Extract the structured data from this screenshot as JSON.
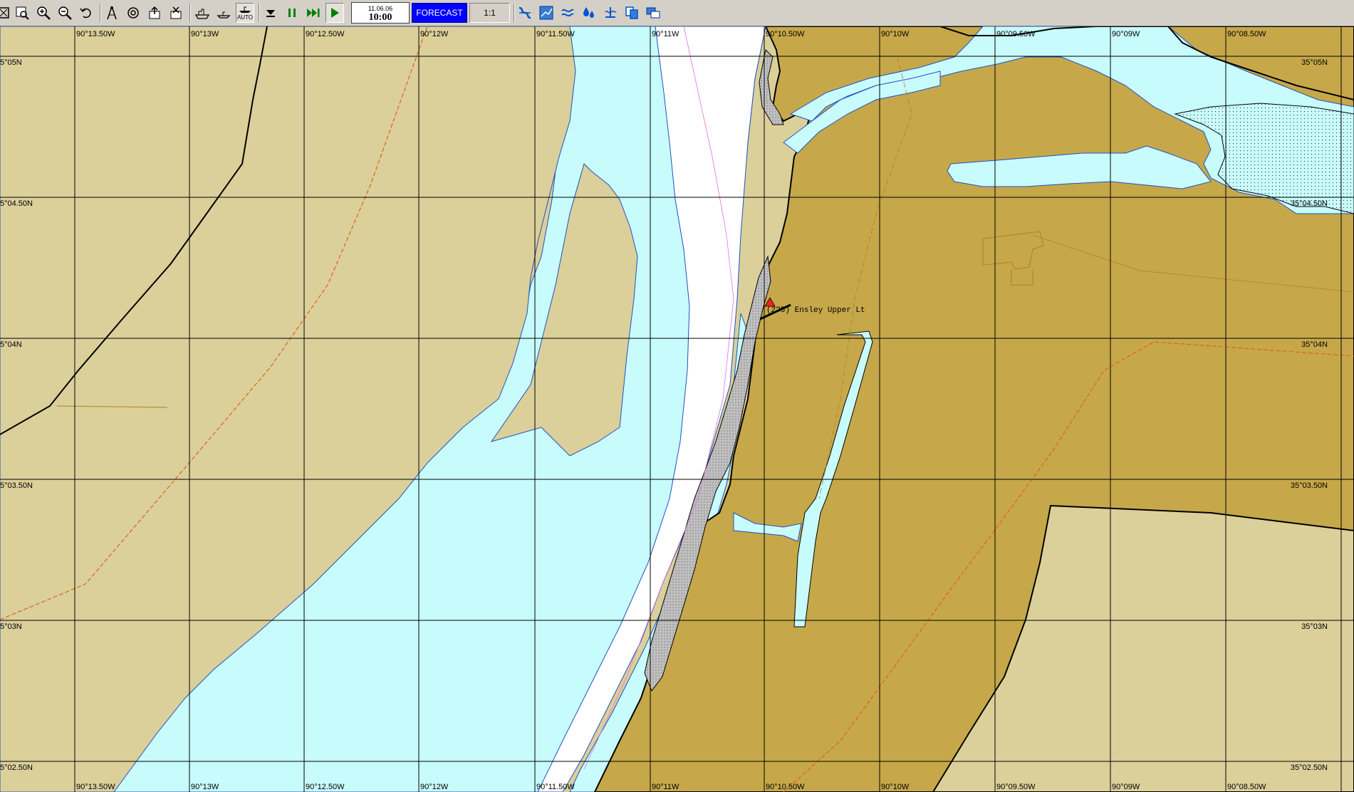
{
  "toolbar": {
    "buttons": [
      {
        "name": "select-icon"
      },
      {
        "name": "zoom-window-icon"
      },
      {
        "name": "zoom-in-icon"
      },
      {
        "name": "zoom-out-icon"
      },
      {
        "name": "undo-view-icon"
      },
      {
        "name": "compass-icon"
      },
      {
        "name": "target-icon"
      },
      {
        "name": "export-icon"
      },
      {
        "name": "delete-object-icon"
      },
      {
        "name": "ship-icon"
      },
      {
        "name": "own-ship-icon"
      },
      {
        "name": "auto-ship-icon",
        "label": "AUTO"
      },
      {
        "name": "stop-icon"
      },
      {
        "name": "pause-icon"
      },
      {
        "name": "fast-forward-icon"
      },
      {
        "name": "play-icon"
      },
      {
        "name": "layers-icon"
      },
      {
        "name": "chart-view-icon"
      },
      {
        "name": "weather-icon"
      },
      {
        "name": "depth-icon"
      },
      {
        "name": "tide-icon"
      },
      {
        "name": "copy-icon"
      },
      {
        "name": "windows-icon"
      }
    ],
    "time": {
      "date": "11.06.06",
      "time": "10:00"
    },
    "forecast_label": "FORECAST",
    "scale_label": "1:1"
  },
  "chart": {
    "colors": {
      "land_light": "#dbd09a",
      "land_dark": "#c6a84a",
      "water_shallow": "#c8fbfb",
      "water_deep": "#ffffff",
      "grid": "#000000"
    },
    "lon_labels": [
      "90°13.50W",
      "90°13W",
      "90°12.50W",
      "90°12W",
      "90°11.50W",
      "90°11W",
      "90°10.50W",
      "90°10W",
      "90°09.50W",
      "90°09W",
      "90°08.50W"
    ],
    "lat_labels_left": [
      "5°05N",
      "5°04.50N",
      "5°04N",
      "5°03.50N",
      "5°03N",
      "5°02.50N"
    ],
    "lat_labels_right": [
      "35°05N",
      "35°04.50N",
      "35°04N",
      "35°03.50N",
      "35°03N",
      "35°02.50N"
    ],
    "feature_label": "(2?5) Ensley Upper Lt"
  }
}
